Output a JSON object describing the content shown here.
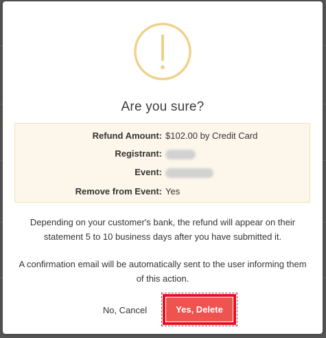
{
  "dialog": {
    "icon": "exclamation-circle-icon",
    "title": "Are you sure?",
    "details": [
      {
        "label": "Refund Amount:",
        "value": "$102.00 by Credit Card"
      },
      {
        "label": "Registrant:",
        "value": ""
      },
      {
        "label": "Event:",
        "value": ""
      },
      {
        "label": "Remove from Event:",
        "value": "Yes"
      }
    ],
    "message_1": "Depending on your customer's bank, the refund will appear on their statement 5 to 10 business days after you have submitted it.",
    "message_2": "A confirmation email will be automatically sent to the user informing them of this action.",
    "cancel_label": "No, Cancel",
    "confirm_label": "Yes, Delete"
  },
  "colors": {
    "warning_icon": "#f0d18a",
    "details_background": "#fdf6ea",
    "confirm_button": "#ef5350",
    "focus_highlight": "#e8101c"
  }
}
